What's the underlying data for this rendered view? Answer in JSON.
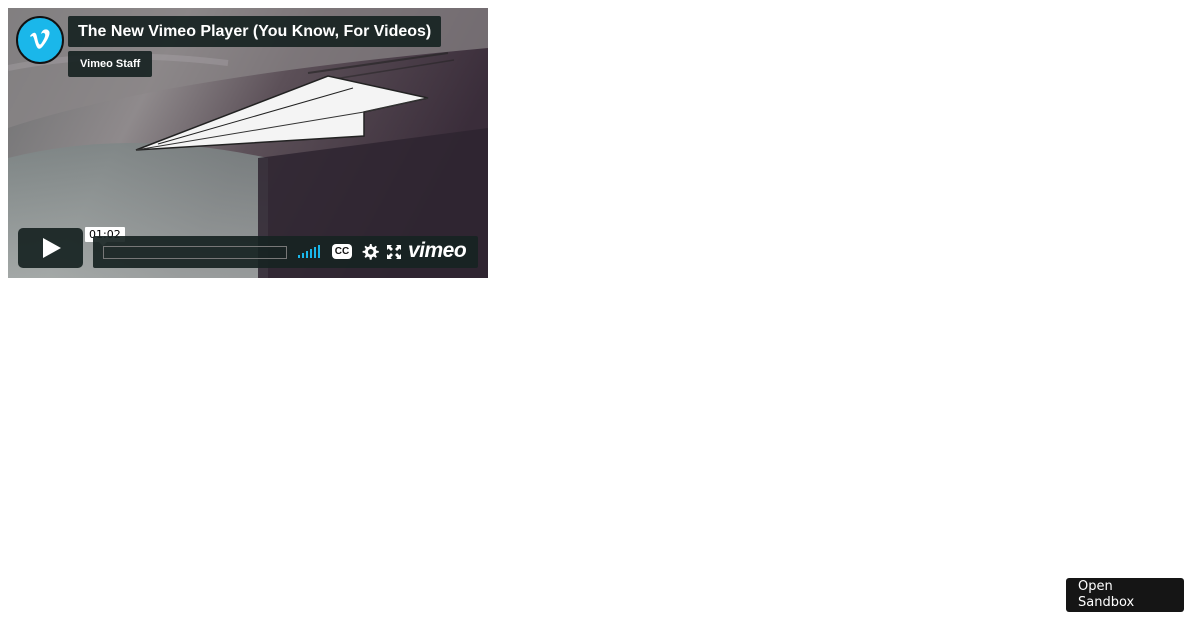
{
  "player": {
    "title": "The New Vimeo Player (You Know, For Videos)",
    "byline": "Vimeo Staff",
    "time_tooltip": "01:02",
    "progress": 0,
    "cc_label": "CC",
    "logo_text": "vimeo",
    "brand_color": "#1ab7ea",
    "icons": {
      "badge": "vimeo-v-icon",
      "play": "play-icon",
      "volume": "volume-bars-icon",
      "settings": "gear-icon",
      "fullscreen": "fullscreen-icon"
    }
  },
  "sandbox": {
    "open_label": "Open Sandbox"
  }
}
